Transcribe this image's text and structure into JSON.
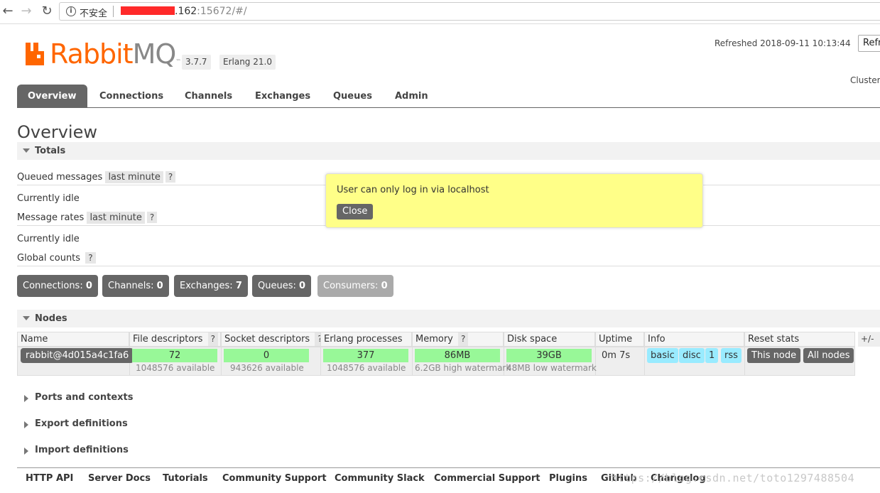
{
  "browser": {
    "insecure_label": "不安全",
    "url_host_suffix": ".162",
    "url_port": ":15672",
    "url_path": "/#/"
  },
  "header": {
    "logo_rabbit": "Rabbit",
    "logo_mq": "MQ",
    "logo_tm": "™",
    "version": "3.7.7",
    "erlang": "Erlang 21.0",
    "refreshed": "Refreshed 2018-09-11 10:13:44",
    "refresh_button": "Refr",
    "cluster": "Cluster"
  },
  "tabs": [
    "Overview",
    "Connections",
    "Channels",
    "Exchanges",
    "Queues",
    "Admin"
  ],
  "page_title": "Overview",
  "totals": {
    "heading": "Totals",
    "queued_messages": "Queued messages",
    "queued_range": "last minute",
    "help": "?",
    "idle_1": "Currently idle",
    "message_rates": "Message rates",
    "rates_range": "last minute",
    "idle_2": "Currently idle",
    "global_counts": "Global counts"
  },
  "counts": [
    {
      "label": "Connections: ",
      "value": "0"
    },
    {
      "label": "Channels: ",
      "value": "0"
    },
    {
      "label": "Exchanges: ",
      "value": "7"
    },
    {
      "label": "Queues: ",
      "value": "0"
    },
    {
      "label": "Consumers: ",
      "value": "0"
    }
  ],
  "nodes": {
    "heading": "Nodes",
    "columns": [
      "Name",
      "File descriptors",
      "Socket descriptors",
      "Erlang processes",
      "Memory",
      "Disk space",
      "Uptime",
      "Info",
      "Reset stats"
    ],
    "plus_minus": "+/-",
    "row": {
      "name": "rabbit@4d015a4c1fa6",
      "file_desc": "72",
      "file_desc_avail": "1048576 available",
      "socket_desc": "0",
      "socket_desc_avail": "943626 available",
      "erlang_proc": "377",
      "erlang_proc_avail": "1048576 available",
      "memory": "86MB",
      "memory_sub": "6.2GB high watermark",
      "disk": "39GB",
      "disk_sub": "48MB low watermark",
      "uptime": "0m 7s",
      "info_tags": [
        "basic",
        "disc",
        "1",
        "rss"
      ],
      "reset_this": "This node",
      "reset_all": "All nodes"
    }
  },
  "sections": [
    "Ports and contexts",
    "Export definitions",
    "Import definitions"
  ],
  "footer": [
    "HTTP API",
    "Server Docs",
    "Tutorials",
    "Community Support",
    "Community Slack",
    "Commercial Support",
    "Plugins",
    "GitHub",
    "Changelog"
  ],
  "watermark": "https://blog.csdn.net/toto1297488504",
  "popup": {
    "message": "User can only log in via localhost",
    "close": "Close"
  },
  "colors": {
    "brand": "#ff6600",
    "tab_active": "#666666",
    "bar_green": "#98f898",
    "info_blue": "#99ebff",
    "popup_yellow": "#ffff88"
  }
}
